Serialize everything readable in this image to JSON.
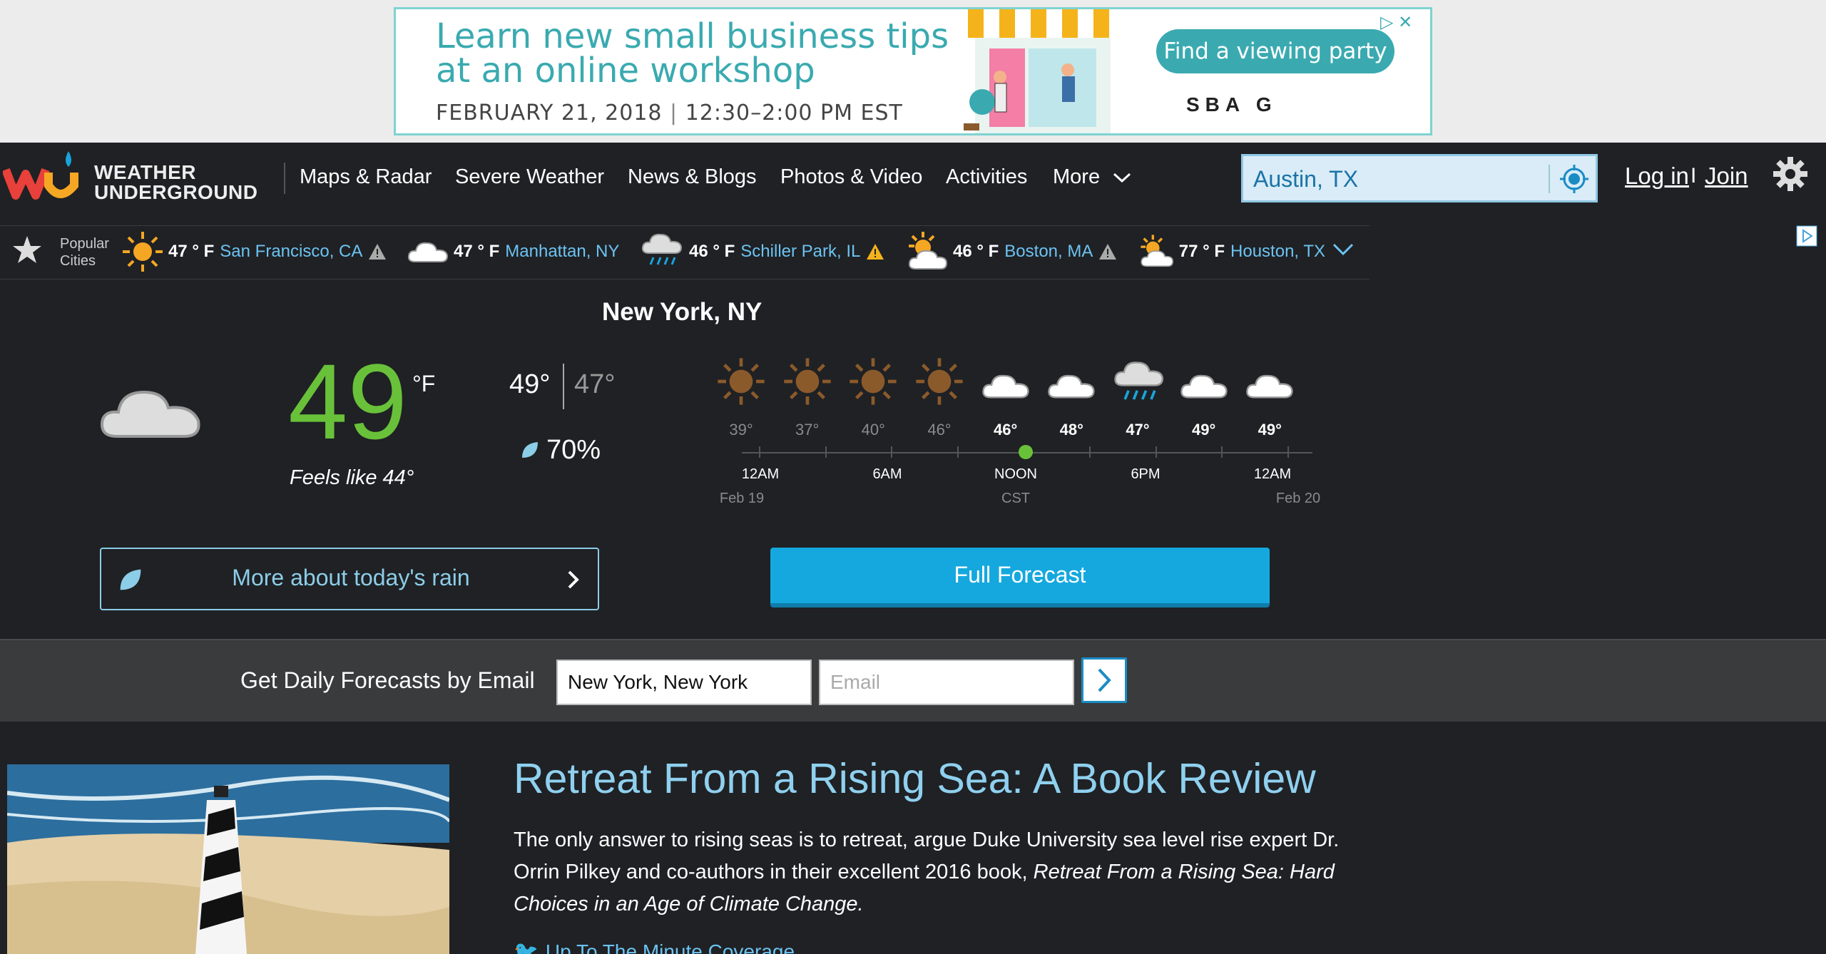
{
  "ad": {
    "headline": "Learn new small business tips at an online workshop",
    "date": "FEBRUARY 21, 2018",
    "time": "12:30–2:00 PM EST",
    "cta": "Find a viewing party",
    "sponsors": "SBA G",
    "colors": {
      "accent": "#3aaab0"
    }
  },
  "header": {
    "logo_text": "WEATHER\nUNDERGROUND",
    "nav": [
      "Maps & Radar",
      "Severe Weather",
      "News & Blogs",
      "Photos & Video",
      "Activities",
      "More"
    ],
    "search_value": "Austin, TX",
    "login": "Log in",
    "separator": "I",
    "join": "Join"
  },
  "popular": {
    "label": "Popular\nCities",
    "cities": [
      {
        "temp": "47 ° F",
        "name": "San Francisco, CA",
        "icon": "sun-icon",
        "alert": true
      },
      {
        "temp": "47 ° F",
        "name": "Manhattan, NY",
        "icon": "cloud-icon",
        "alert": false
      },
      {
        "temp": "46 ° F",
        "name": "Schiller Park, IL",
        "icon": "rain-icon",
        "alert": true
      },
      {
        "temp": "46 ° F",
        "name": "Boston, MA",
        "icon": "partly-cloudy-icon",
        "alert": true
      },
      {
        "temp": "77 ° F",
        "name": "Houston, TX",
        "icon": "partly-cloudy-icon",
        "alert": false
      }
    ]
  },
  "current": {
    "location": "New York, NY",
    "temp": "49",
    "unit": "°F",
    "feels_like": "Feels like 44°",
    "high": "49°",
    "low": "47°",
    "precip": "70%",
    "temp_color": "#69c13a"
  },
  "hourly": {
    "temps": [
      "39°",
      "37°",
      "40°",
      "46°",
      "46°",
      "48°",
      "47°",
      "49°",
      "49°"
    ],
    "icons": [
      "sun-icon",
      "sun-icon",
      "sun-icon",
      "sun-icon",
      "cloud-icon",
      "cloud-icon",
      "rain-icon",
      "cloud-icon",
      "cloud-icon"
    ],
    "time_labels": [
      "12AM",
      "6AM",
      "NOON",
      "6PM",
      "12AM"
    ],
    "sub_labels": [
      "Feb 19",
      "CST",
      "Feb 20"
    ]
  },
  "buttons": {
    "rain": "More about today's rain",
    "forecast": "Full Forecast"
  },
  "email": {
    "heading": "Get Daily Forecasts by Email",
    "city_value": "New York, New York",
    "email_placeholder": "Email"
  },
  "article": {
    "title": "Retreat From a Rising Sea: A Book Review",
    "body_plain": "The only answer to rising seas is to retreat, argue Duke University sea level rise expert Dr. Orrin Pilkey and co-authors in their excellent 2016 book, ",
    "body_italic": "Retreat From a Rising Sea: Hard Choices in an Age of Climate Change.",
    "coverage_link": "Up To The Minute Coverage"
  }
}
